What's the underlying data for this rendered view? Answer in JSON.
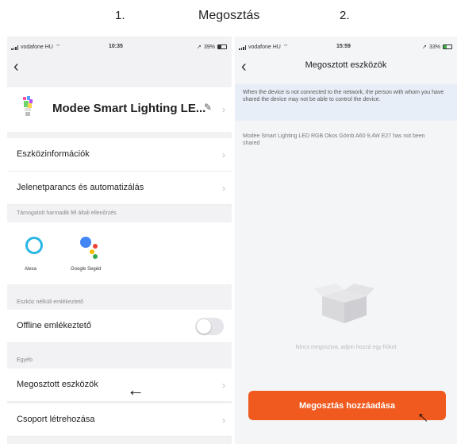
{
  "header": {
    "step_one": "1.",
    "title": "Megosztás",
    "step_two": "2."
  },
  "left_screen": {
    "status": {
      "carrier": "vodafone HU",
      "time": "10:35",
      "battery": "39%"
    },
    "device_name": "Modee Smart Lighting LE...",
    "rows": {
      "device_info": "Eszközinformációk",
      "scene_automation": "Jelenetparancs és automatizálás"
    },
    "section_third_party": "Támogatott harmadik fél általi ellenőrzés",
    "voice": {
      "alexa": "Alexa",
      "google": "Google Segéd"
    },
    "section_offline": "Eszköz nélküli emlékeztető",
    "offline_reminder": "Offline emlékeztető",
    "section_other": "Egyéb",
    "shared_devices": "Megosztott eszközök",
    "create_group": "Csoport létrehozása"
  },
  "right_screen": {
    "status": {
      "carrier": "vodafone HU",
      "time": "15:59",
      "battery": "33%"
    },
    "title": "Megosztott eszközök",
    "info_text": "When the device is not connected to the network, the person with whom you have shared the device may not be able to control the device.",
    "not_shared_text": "Modee Smart Lighting LED RGB Okos Gömb A60 9,4W E27 has not been shared",
    "empty_text": "Nincs megosztva, adjon hozzá egy fiókot",
    "add_button": "Megosztás hozzáadása"
  },
  "colors": {
    "accent": "#f05a1f",
    "info_bg": "#e8eef7",
    "alexa": "#2ab7e6"
  }
}
